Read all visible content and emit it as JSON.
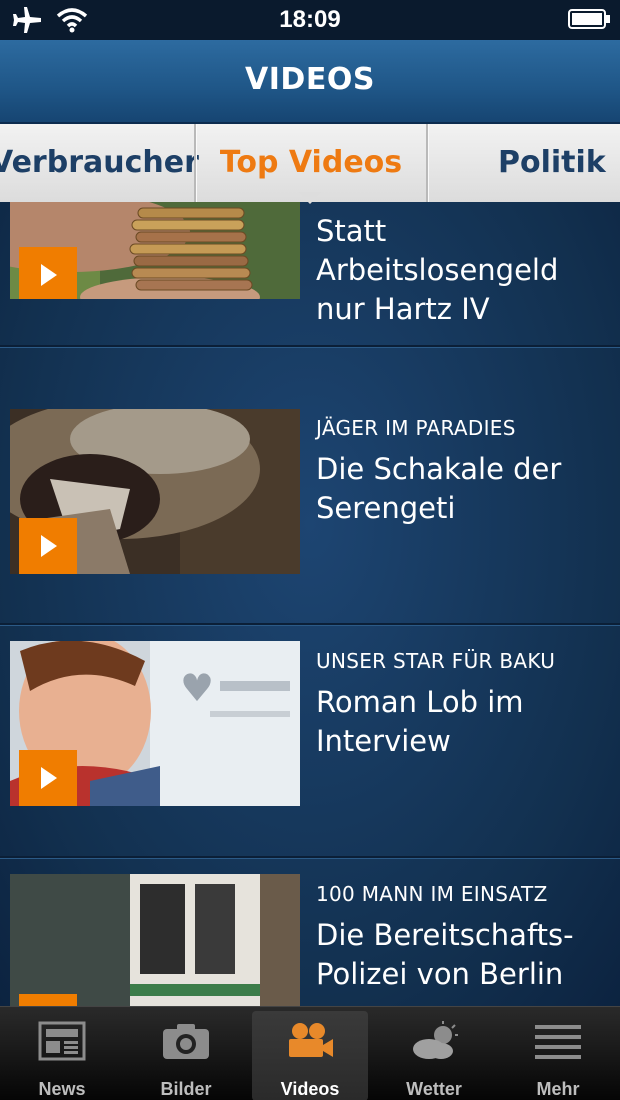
{
  "status_bar": {
    "time": "18:09"
  },
  "header": {
    "title": "VIDEOS"
  },
  "tabs": {
    "left": "Verbraucher",
    "active": "Top Videos",
    "right": "Politik"
  },
  "items": [
    {
      "kicker": "",
      "headline": "Statt Arbeitslosengeld nur Hartz IV"
    },
    {
      "kicker": "JÄGER IM PARADIES",
      "headline": "Die Schakale der Serengeti"
    },
    {
      "kicker": "UNSER STAR FÜR BAKU",
      "headline": "Roman Lob im Interview"
    },
    {
      "kicker": "100 MANN IM EINSATZ",
      "headline": "Die Bereitschafts-Polizei von Berlin"
    }
  ],
  "tabbar": [
    {
      "label": "News",
      "icon": "newspaper-icon"
    },
    {
      "label": "Bilder",
      "icon": "camera-icon"
    },
    {
      "label": "Videos",
      "icon": "video-camera-icon",
      "active": true
    },
    {
      "label": "Wetter",
      "icon": "weather-cloud-icon"
    },
    {
      "label": "Mehr",
      "icon": "more-lines-icon"
    }
  ],
  "colors": {
    "accent": "#f07d00",
    "header": "#1f5687",
    "tab_active": "#ee7a12"
  }
}
